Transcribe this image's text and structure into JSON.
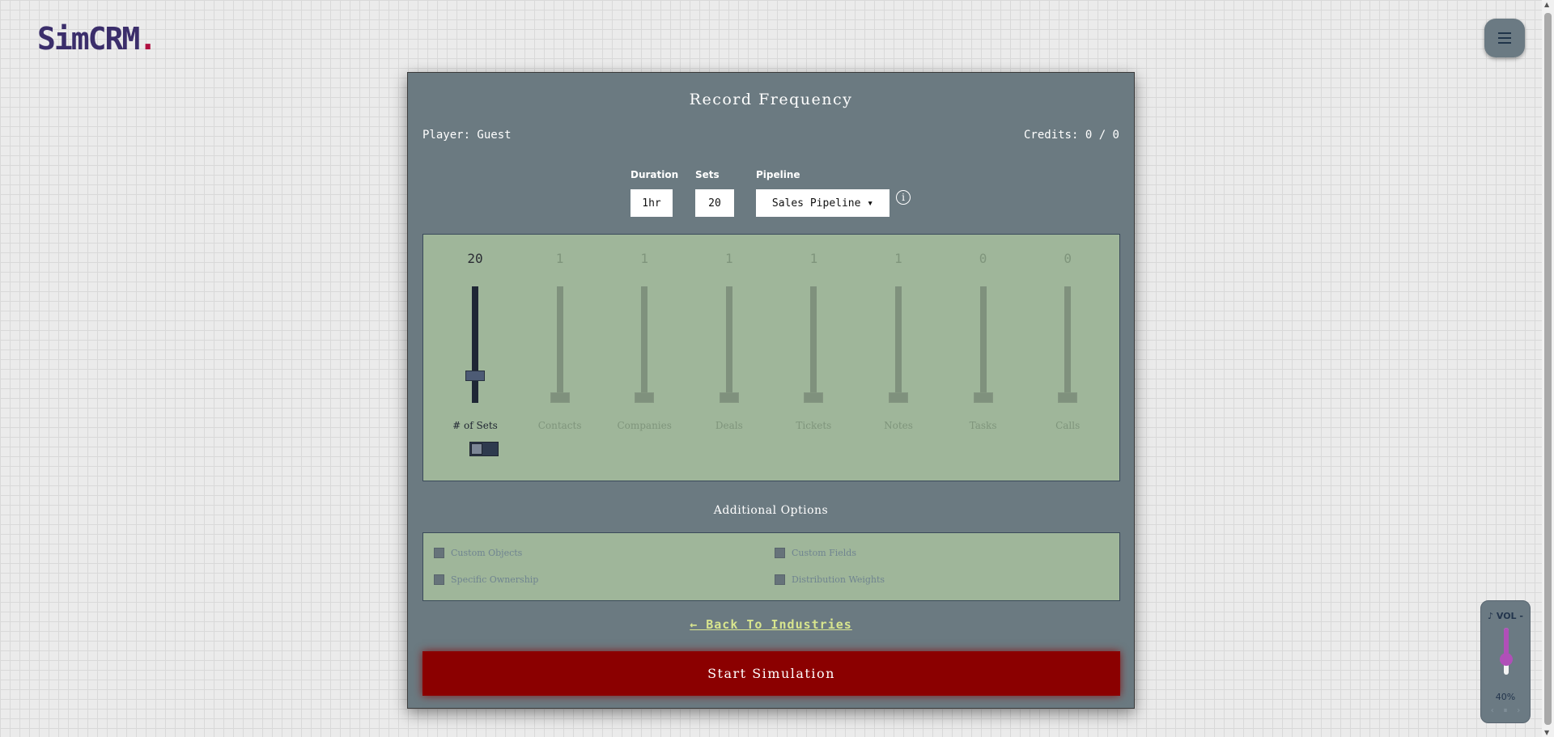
{
  "header": {
    "logo_text": "SimCRM",
    "logo_dot": "."
  },
  "modal": {
    "title": "Record Frequency",
    "player": "Player: Guest",
    "credits": "Credits: 0 / 0",
    "fields": {
      "duration_label": "Duration",
      "duration_value": "1hr",
      "sets_label": "Sets",
      "sets_value": "20",
      "pipeline_label": "Pipeline",
      "pipeline_value": "Sales Pipeline ▾",
      "info_icon": "i"
    },
    "sliders": [
      {
        "label": "# of Sets",
        "value": "20",
        "level": 0.2,
        "active": true
      },
      {
        "label": "Contacts",
        "value": "1",
        "level": 0.0,
        "active": false
      },
      {
        "label": "Companies",
        "value": "1",
        "level": 0.0,
        "active": false
      },
      {
        "label": "Deals",
        "value": "1",
        "level": 0.0,
        "active": false
      },
      {
        "label": "Tickets",
        "value": "1",
        "level": 0.0,
        "active": false
      },
      {
        "label": "Notes",
        "value": "1",
        "level": 0.0,
        "active": false
      },
      {
        "label": "Tasks",
        "value": "0",
        "level": 0.0,
        "active": false
      },
      {
        "label": "Calls",
        "value": "0",
        "level": 0.0,
        "active": false
      }
    ],
    "additional_title": "Additional Options",
    "options": {
      "custom_objects": "Custom Objects",
      "custom_fields": "Custom Fields",
      "specific_ownership": "Specific Ownership",
      "distribution_weights": "Distribution Weights"
    },
    "back_link": "← Back To Industries",
    "start_button": "Start Simulation"
  },
  "volume": {
    "label": "♪ VOL -",
    "percent_text": "40%",
    "level": 0.4,
    "prev": "‹",
    "pause": "⏸",
    "next": "›"
  },
  "colors": {
    "accent_red": "#8b0000",
    "panel_green": "#9fb69a",
    "modal_slate": "#6b7a81",
    "volume_purple": "#b04fb8"
  }
}
